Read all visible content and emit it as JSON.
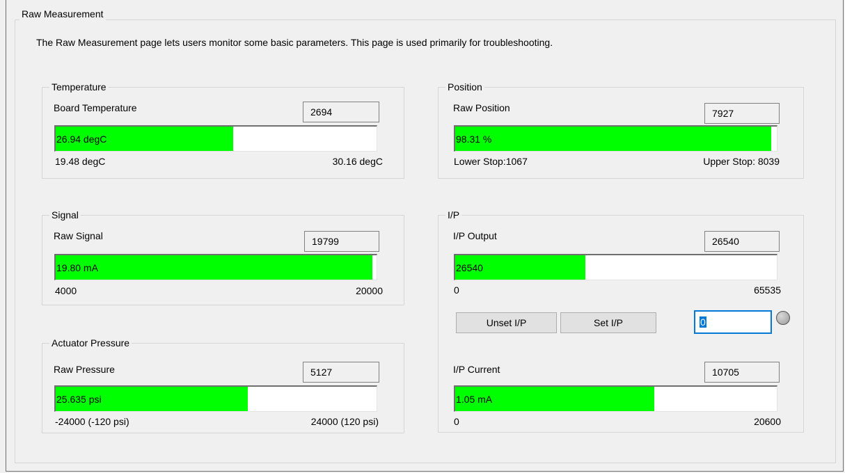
{
  "page": {
    "title": "Raw Measurement",
    "description": "The Raw Measurement page lets users monitor some basic parameters. This page is used primarily for troubleshooting."
  },
  "temperature": {
    "group_label": "Temperature",
    "field_label": "Board Temperature",
    "raw_value": "2694",
    "bar_text": "26.94 degC",
    "bar_fraction": 0.553,
    "min_label": "19.48 degC",
    "max_label": "30.16 degC"
  },
  "position": {
    "group_label": "Position",
    "field_label": "Raw Position",
    "raw_value": "7927",
    "bar_text": "98.31 %",
    "bar_fraction": 0.983,
    "min_label": "Lower Stop:1067",
    "max_label": "Upper Stop:  8039"
  },
  "signal": {
    "group_label": "Signal",
    "field_label": "Raw Signal",
    "raw_value": "19799",
    "bar_text": "19.80 mA",
    "bar_fraction": 0.987,
    "min_label": "4000",
    "max_label": "20000"
  },
  "ip": {
    "group_label": "I/P",
    "output": {
      "field_label": "I/P Output",
      "raw_value": "26540",
      "bar_text": "26540",
      "bar_fraction": 0.405,
      "min_label": "0",
      "max_label": "65535"
    },
    "unset_button": "Unset I/P",
    "set_button": "Set I/P",
    "input_value": "0",
    "current": {
      "field_label": "I/P Current",
      "raw_value": "10705",
      "bar_text": "1.05 mA",
      "bar_fraction": 0.62,
      "min_label": "0",
      "max_label": "20600"
    }
  },
  "pressure": {
    "group_label": "Actuator Pressure",
    "field_label": "Raw Pressure",
    "raw_value": "5127",
    "bar_text": "25.635 psi",
    "bar_fraction": 0.599,
    "min_label": "-24000 (-120 psi)",
    "max_label": "24000 (120 psi)"
  }
}
